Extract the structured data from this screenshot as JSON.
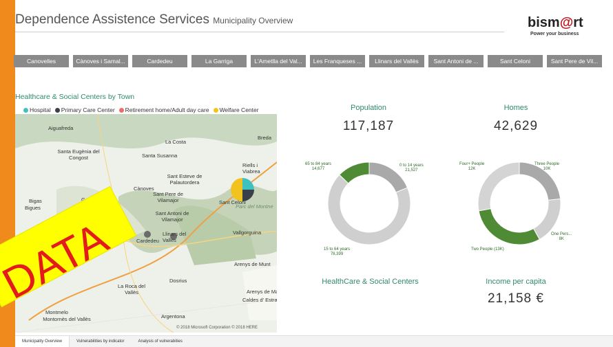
{
  "header": {
    "title": "Dependence Assistence Services",
    "subtitle": "Municipality Overview",
    "logo_main": "bism",
    "logo_at": "@",
    "logo_end": "rt",
    "tagline": "Power your business"
  },
  "towns": [
    "Canovelles",
    "Cànoves i Samal...",
    "Cardedeu",
    "La Garriga",
    "L'Ametlla del Val...",
    "Les Franqueses ...",
    "Llinars del Vallès",
    "Sant Antoni de ...",
    "Sant Celoni",
    "Sant Pere de Vil..."
  ],
  "map": {
    "title": "Healthcare & Social Centers by Town",
    "legend": [
      {
        "label": "Hospital",
        "color": "#3fc1c0"
      },
      {
        "label": "Primary Care Center",
        "color": "#3a3f4a"
      },
      {
        "label": "Retirement home/Adult day care",
        "color": "#ef6b6b"
      },
      {
        "label": "Welfare Center",
        "color": "#f2c31f"
      }
    ],
    "labels": [
      "Aiguafreda",
      "La Costa",
      "Breda",
      "Santa Eugènia del Congost",
      "Santa Susanna",
      "Riells i Viabrea",
      "Sant Esteve de Palautordera",
      "Cànoves",
      "Sant Pere de Vilamajor",
      "Sant Celoni",
      "Parc del Montne",
      "Bigas",
      "Garriga",
      "Bigues",
      "Sant Antoni de Vilamajor",
      "Cardedeu",
      "Llinars del Vallès",
      "Vallgorguina",
      "Arenys de Munt",
      "Dosrius",
      "La Roca del Vallès",
      "Arenys de Ma",
      "Caldes d' Estrac",
      "Argentona",
      "Montornès del Vallès",
      "Montmelo"
    ],
    "copyright": "© 2018 Microsoft Corporation    © 2018 HERE"
  },
  "population": {
    "title": "Population",
    "value": "117,187",
    "labels": {
      "a": "65 to 84 years\n14,677",
      "b": "0 to 14 years\n21,527",
      "c": "15 to 64 years\n78,399"
    }
  },
  "homes": {
    "title": "Homes",
    "value": "42,629",
    "labels": {
      "a": "Four+ People\n12K",
      "b": "Three People\n10K",
      "c": "One Pers...\n8K",
      "d": "Two People (13K)"
    }
  },
  "centers": {
    "title": "HealthCare & Social Centers"
  },
  "income": {
    "title": "Income per capita",
    "value": "21,158 €"
  },
  "bottom_tabs": [
    "Municipality Overview",
    "Vulnerabilities by indicator",
    "Analysis of vulnerabities"
  ],
  "stamp": "DATA",
  "chart_data": [
    {
      "type": "pie",
      "title": "Population",
      "categories": [
        "0 to 14 years",
        "15 to 64 years",
        "65 to 84 years"
      ],
      "values": [
        21527,
        78399,
        14677
      ]
    },
    {
      "type": "pie",
      "title": "Homes",
      "categories": [
        "Three People",
        "One Pers...",
        "Two People",
        "Four+ People"
      ],
      "values": [
        10,
        8,
        13,
        12
      ]
    }
  ]
}
